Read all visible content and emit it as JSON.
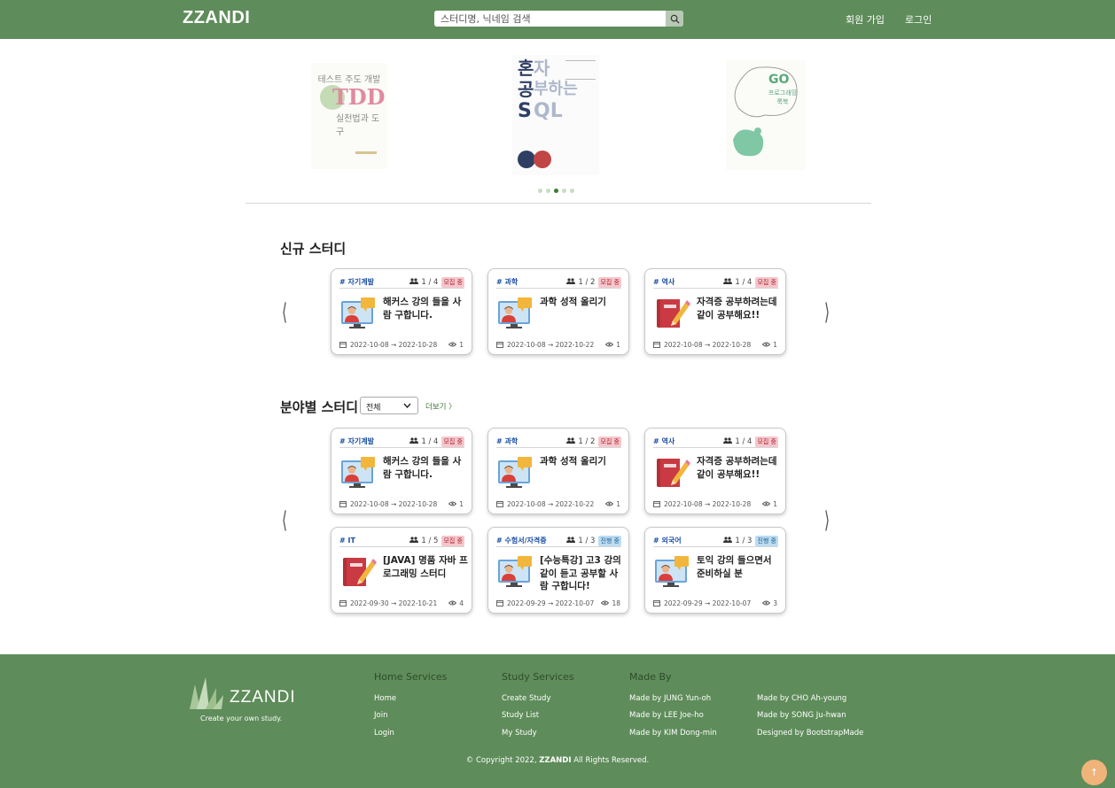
{
  "nav": {
    "logo": "ZZANDI",
    "search_placeholder": "스터디명, 닉네임 검색",
    "signup": "회원 가입",
    "login": "로그인"
  },
  "carousel": {
    "books": [
      {
        "title_top": "테스트 주도 개발",
        "title_main": "TDD",
        "title_sub": "실천법과 도구"
      },
      {
        "chars": [
          "혼",
          "자",
          "공",
          "부하는",
          "S",
          "QL"
        ]
      },
      {
        "title_main": "GO",
        "title_sub": "프로그래밍 룩북"
      }
    ],
    "dot_count": 5,
    "active_dot": 2
  },
  "new_studies": {
    "title": "신규 스터디",
    "cards": [
      {
        "category": "# 자기계발",
        "members": "1 / 4",
        "status": "모집 중",
        "status_type": "rec",
        "title": "해커스 강의 들을 사람 구합니다.",
        "icon": "computer-teacher-icon",
        "date": "2022-10-08 → 2022-10-28",
        "views": "1"
      },
      {
        "category": "# 과학",
        "members": "1 / 2",
        "status": "모집 중",
        "status_type": "rec",
        "title": "과학 성적 올리기",
        "icon": "computer-teacher-icon",
        "date": "2022-10-08 → 2022-10-22",
        "views": "1"
      },
      {
        "category": "# 역사",
        "members": "1 / 4",
        "status": "모집 중",
        "status_type": "rec",
        "title": "자격증 공부하려는데 같이 공부해요!!",
        "icon": "book-pencil-icon",
        "date": "2022-10-08 → 2022-10-28",
        "views": "1"
      }
    ]
  },
  "field_studies": {
    "title": "분야별 스터디",
    "select_value": "전체",
    "more": "더보기 〉",
    "cards": [
      {
        "category": "# 자기계발",
        "members": "1 / 4",
        "status": "모집 중",
        "status_type": "rec",
        "title": "해커스 강의 들을 사람 구합니다.",
        "icon": "computer-teacher-icon",
        "date": "2022-10-08 → 2022-10-28",
        "views": "1"
      },
      {
        "category": "# 과학",
        "members": "1 / 2",
        "status": "모집 중",
        "status_type": "rec",
        "title": "과학 성적 올리기",
        "icon": "computer-teacher-icon",
        "date": "2022-10-08 → 2022-10-22",
        "views": "1"
      },
      {
        "category": "# 역사",
        "members": "1 / 4",
        "status": "모집 중",
        "status_type": "rec",
        "title": "자격증 공부하려는데 같이 공부해요!!",
        "icon": "book-pencil-icon",
        "date": "2022-10-08 → 2022-10-28",
        "views": "1"
      },
      {
        "category": "# IT",
        "members": "1 / 5",
        "status": "모집 중",
        "status_type": "rec",
        "title": "[JAVA] 명품 자바 프로그래밍 스터디",
        "icon": "book-pencil-icon",
        "date": "2022-09-30 → 2022-10-21",
        "views": "4"
      },
      {
        "category": "# 수험서/자격증",
        "members": "1 / 3",
        "status": "진행 중",
        "status_type": "prog",
        "title": "[수능특강] 고3 강의 같이 듣고 공부할 사람 구합니다!",
        "icon": "computer-teacher-icon",
        "date": "2022-09-29 → 2022-10-07",
        "views": "18"
      },
      {
        "category": "# 외국어",
        "members": "1 / 3",
        "status": "진행 중",
        "status_type": "prog",
        "title": "토익 강의 들으면서 준비하실 분",
        "icon": "computer-teacher-icon",
        "date": "2022-09-29 → 2022-10-07",
        "views": "3"
      }
    ]
  },
  "footer": {
    "logo": "ZZANDI",
    "tagline": "Create your own study.",
    "home_services": {
      "title": "Home Services",
      "links": [
        "Home",
        "Join",
        "Login"
      ]
    },
    "study_services": {
      "title": "Study Services",
      "links": [
        "Create Study",
        "Study List",
        "My Study"
      ]
    },
    "made_by": {
      "title": "Made By",
      "col1": [
        "Made by JUNG Yun-oh",
        "Made by LEE Joe-ho",
        "Made by KIM Dong-min"
      ],
      "col2": [
        "Made by CHO Ah-young",
        "Made by SONG Ju-hwan",
        "Designed by BootstrapMade"
      ]
    },
    "copyright_pre": "© Copyright 2022,",
    "copyright_brand": "ZZANDI",
    "copyright_post": "All Rights Reserved."
  },
  "colors": {
    "brand_green": "#5e8c5a",
    "category_blue": "#1b4ea3",
    "recruit_bg": "#f5c7cc",
    "progress_bg": "#bcdcf1",
    "top_button": "#f0b37a"
  }
}
